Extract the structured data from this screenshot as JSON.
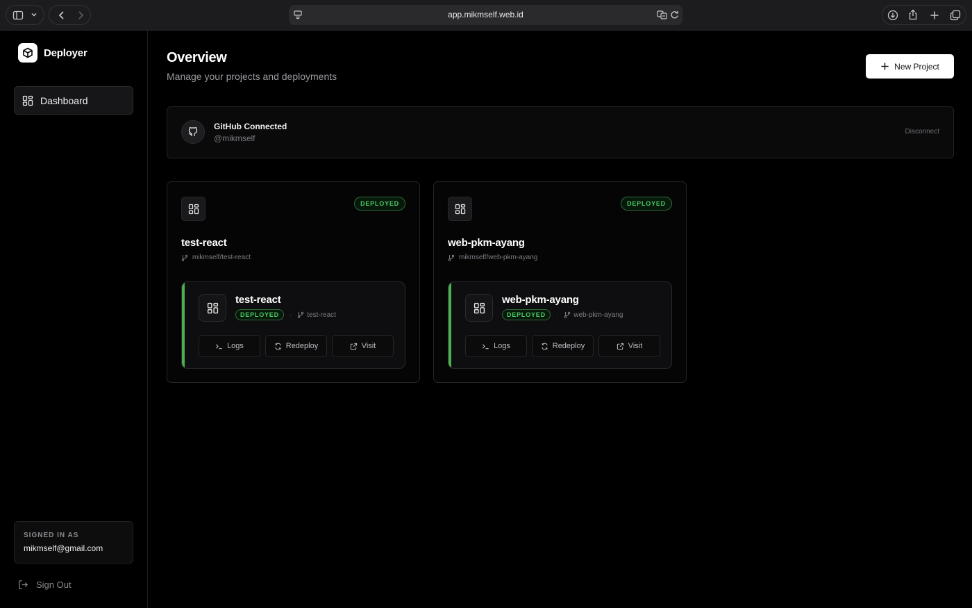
{
  "browser": {
    "url": "app.mikmself.web.id"
  },
  "sidebar": {
    "brand": "Deployer",
    "nav": [
      {
        "label": "Dashboard",
        "icon": "dashboard-icon",
        "active": true
      }
    ],
    "account": {
      "caption": "SIGNED IN AS",
      "email": "mikmself@gmail.com"
    },
    "sign_out_label": "Sign Out"
  },
  "main": {
    "title": "Overview",
    "subtitle": "Manage your projects and deployments",
    "new_project_label": "New Project",
    "github": {
      "title": "GitHub Connected",
      "username": "@mikmself",
      "disconnect_label": "Disconnect"
    },
    "projects": [
      {
        "name": "test-react",
        "repo": "mikmself/test-react",
        "status": "DEPLOYED",
        "deployment": {
          "name": "test-react",
          "status": "DEPLOYED",
          "branch": "test-react",
          "separator": "·",
          "actions": {
            "logs": "Logs",
            "redeploy": "Redeploy",
            "visit": "Visit"
          }
        }
      },
      {
        "name": "web-pkm-ayang",
        "repo": "mikmself/web-pkm-ayang",
        "status": "DEPLOYED",
        "deployment": {
          "name": "web-pkm-ayang",
          "status": "DEPLOYED",
          "branch": "web-pkm-ayang",
          "separator": "·",
          "actions": {
            "logs": "Logs",
            "redeploy": "Redeploy",
            "visit": "Visit"
          }
        }
      }
    ]
  },
  "colors": {
    "background": "#000000",
    "accent_green": "#4cc964",
    "deploy_bar": "#4caf50",
    "primary_button": "#ffffff"
  }
}
